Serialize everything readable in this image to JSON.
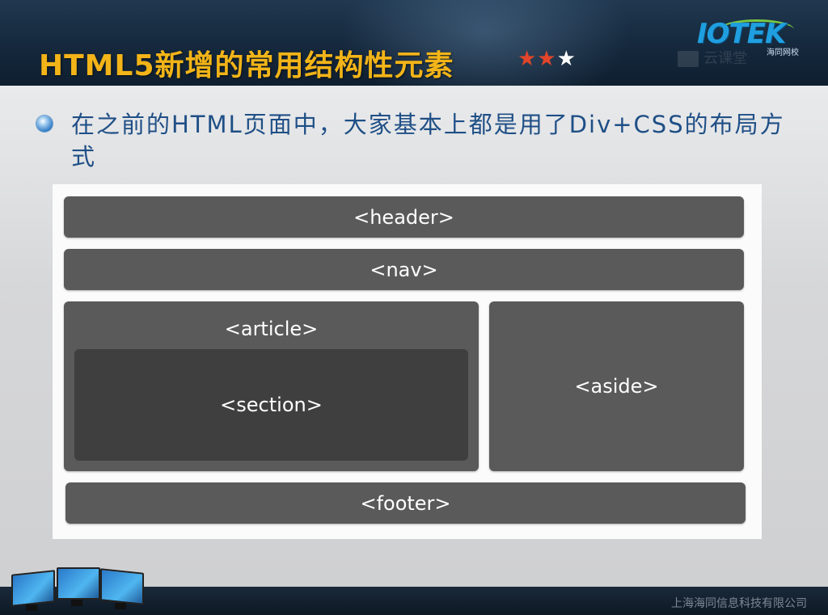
{
  "header": {
    "title": "HTML5新增的常用结构性元素",
    "rating_on": "★★",
    "rating_off": "★"
  },
  "logo": {
    "text": "IOTEK",
    "sub": "海同网校"
  },
  "watermark": {
    "text": "云课堂"
  },
  "bullet": {
    "text": "在之前的HTML页面中，大家基本上都是用了Div+CSS的布局方式"
  },
  "diagram": {
    "header": "<header>",
    "nav": "<nav>",
    "article": "<article>",
    "section": "<section>",
    "aside": "<aside>",
    "footer": "<footer>"
  },
  "footer": {
    "company": "上海海同信息科技有限公司"
  },
  "colors": {
    "title": "#f2b418",
    "bullet_text": "#1f4f86",
    "box": "#5a5a5a",
    "box_inner": "#3f3f3f",
    "star_on": "#e2452a"
  }
}
